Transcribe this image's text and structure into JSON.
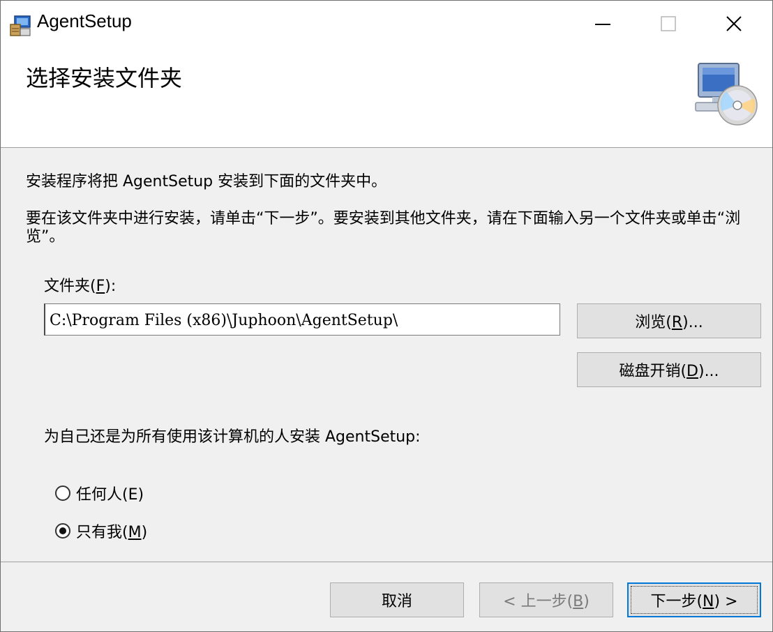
{
  "window": {
    "title": "AgentSetup",
    "controls": {
      "minimize": "—",
      "maximize": "☐",
      "close": "✕"
    }
  },
  "header": {
    "title": "选择安装文件夹",
    "icon": "computer-cd-icon"
  },
  "body": {
    "intro_line1": "安装程序将把 AgentSetup 安装到下面的文件夹中。",
    "intro_line2": "要在该文件夹中进行安装，请单击“下一步”。要安装到其他文件夹，请在下面输入另一个文件夹或单击“浏览”。",
    "folder_label": "文件夹(F):",
    "folder_value": "C:\\Program Files (x86)\\Juphoon\\AgentSetup\\",
    "browse_label": "浏览(R)...",
    "disk_cost_label": "磁盘开销(D)...",
    "scope_label": "为自己还是为所有使用该计算机的人安装 AgentSetup:",
    "radio_anyone": "任何人(E)",
    "radio_only_me": "只有我(M)",
    "selected_scope": "只有我(M)"
  },
  "footer": {
    "cancel_label": "取消",
    "back_label": "< 上一步(B)",
    "next_label": "下一步(N) >"
  }
}
